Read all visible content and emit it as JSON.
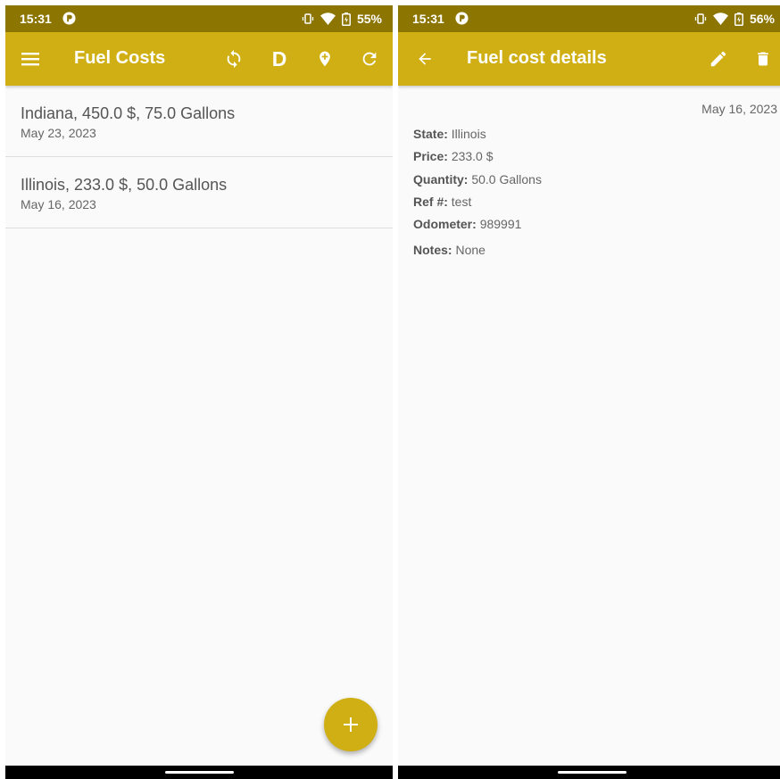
{
  "colors": {
    "status_bar": "#8c7500",
    "app_bar": "#d0af14",
    "accent": "#d0af14",
    "background": "#fafafa",
    "primary_text": "#555555",
    "secondary_text": "#666666"
  },
  "list_screen": {
    "status": {
      "time": "15:31",
      "battery": "55%"
    },
    "appbar": {
      "title": "Fuel Costs",
      "icons": [
        "menu-icon",
        "sync-icon",
        "d-letter-icon",
        "add-location-icon",
        "refresh-icon"
      ],
      "d_label": "D"
    },
    "items": [
      {
        "title": "Indiana, 450.0 $, 75.0 Gallons",
        "date": "May 23, 2023"
      },
      {
        "title": "Illinois, 233.0 $, 50.0 Gallons",
        "date": "May 16, 2023"
      }
    ],
    "fab_icon": "add-icon"
  },
  "detail_screen": {
    "status": {
      "time": "15:31",
      "battery": "56%"
    },
    "appbar": {
      "title": "Fuel cost details",
      "icons": [
        "back-arrow-icon",
        "edit-icon",
        "delete-icon"
      ]
    },
    "date": "May 16, 2023",
    "fields": [
      {
        "label": "State:",
        "value": "Illinois"
      },
      {
        "label": "Price:",
        "value": "233.0 $"
      },
      {
        "label": "Quantity:",
        "value": "50.0 Gallons"
      },
      {
        "label": "Ref #:",
        "value": "test"
      },
      {
        "label": "Odometer:",
        "value": "989991"
      },
      {
        "label": "Notes:",
        "value": "None"
      }
    ]
  }
}
